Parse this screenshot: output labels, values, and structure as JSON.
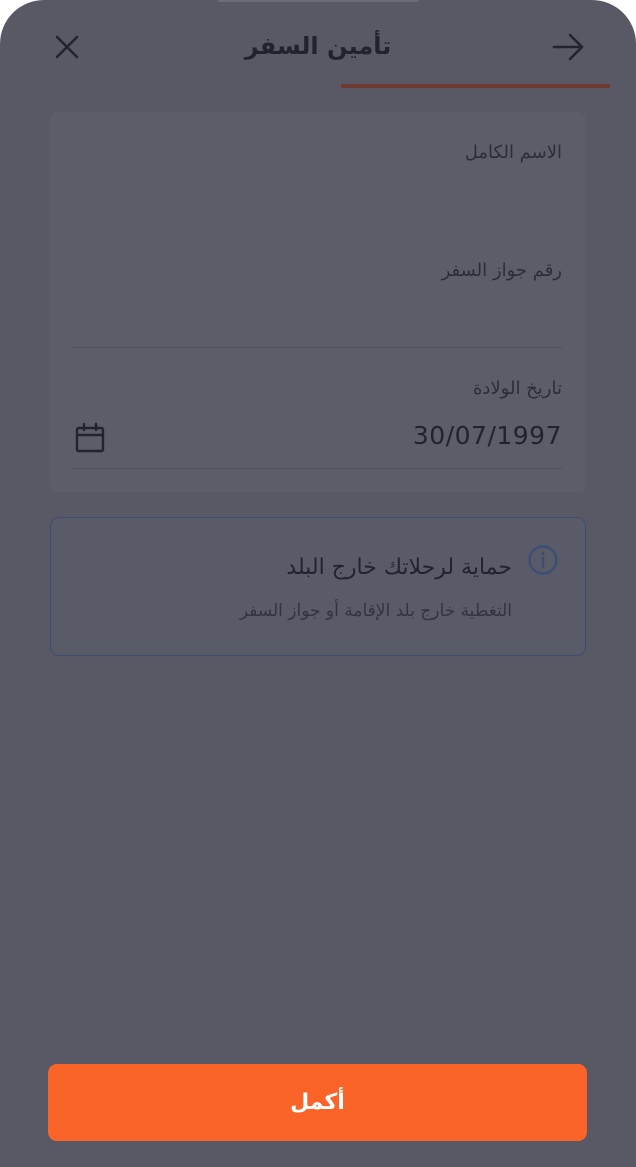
{
  "header": {
    "title": "تأمين السفر",
    "close_icon": "close-icon",
    "back_icon": "arrow-right-icon",
    "progress_fraction": 0.46
  },
  "form": {
    "full_name": {
      "label": "الاسم الكامل",
      "value": ""
    },
    "passport_number": {
      "label": "رقم جواز السفر",
      "value": ""
    },
    "birth_date": {
      "label": "تاريخ الولادة",
      "value": "30/07/1997",
      "icon": "calendar-icon"
    }
  },
  "info": {
    "icon": "info-icon",
    "title": "حماية لرحلاتك خارج البلد",
    "subtitle": "التغطية خارج بلد الإقامة أو جواز السفر",
    "accent_color": "#3d4e72"
  },
  "actions": {
    "continue_label": "أكمل",
    "continue_color": "#fa6428"
  },
  "colors": {
    "overlay_background": "#595965",
    "progress_color": "#6e3a31"
  }
}
